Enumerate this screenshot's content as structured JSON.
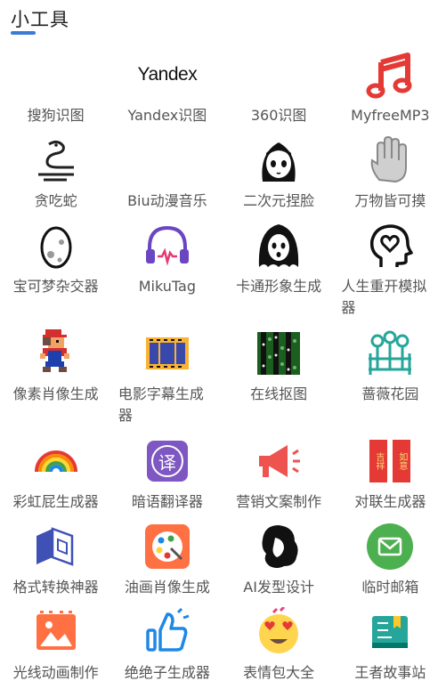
{
  "header": {
    "title": "小工具"
  },
  "tools": [
    {
      "label": "搜狗识图",
      "icon": "sogou-image-recognition-icon"
    },
    {
      "label": "Yandex识图",
      "icon": "yandex-logo-icon",
      "logo_text": "Yandex"
    },
    {
      "label": "360识图",
      "icon": "360-image-recognition-icon"
    },
    {
      "label": "MyfreeMP3",
      "icon": "music-note-icon"
    },
    {
      "label": "贪吃蛇",
      "icon": "snake-icon"
    },
    {
      "label": "Biu动漫音乐",
      "icon": "anime-music-icon"
    },
    {
      "label": "二次元捏脸",
      "icon": "anime-girl-face-icon"
    },
    {
      "label": "万物皆可摸",
      "icon": "hand-icon"
    },
    {
      "label": "宝可梦杂交器",
      "icon": "pokemon-egg-icon"
    },
    {
      "label": "MikuTag",
      "icon": "headphones-icon"
    },
    {
      "label": "卡通形象生成",
      "icon": "cartoon-ghost-icon"
    },
    {
      "label": "人生重开模拟器",
      "icon": "head-heart-icon"
    },
    {
      "label": "像素肖像生成",
      "icon": "pixel-mario-icon"
    },
    {
      "label": "电影字幕生成器",
      "icon": "film-strip-icon"
    },
    {
      "label": "在线抠图",
      "icon": "cutout-image-icon"
    },
    {
      "label": "蔷薇花园",
      "icon": "garden-fence-icon"
    },
    {
      "label": "彩虹屁生成器",
      "icon": "rainbow-icon"
    },
    {
      "label": "暗语翻译器",
      "icon": "translate-icon",
      "badge_text": "译"
    },
    {
      "label": "营销文案制作",
      "icon": "megaphone-icon"
    },
    {
      "label": "对联生成器",
      "icon": "couplet-icon",
      "couplet_left": "吉祥",
      "couplet_right": "如意"
    },
    {
      "label": "格式转换神器",
      "icon": "format-convert-icon"
    },
    {
      "label": "油画肖像生成",
      "icon": "palette-icon"
    },
    {
      "label": "AI发型设计",
      "icon": "hairstyle-icon"
    },
    {
      "label": "临时邮箱",
      "icon": "mail-icon"
    },
    {
      "label": "光线动画制作",
      "icon": "image-frame-icon"
    },
    {
      "label": "绝绝子生成器",
      "icon": "thumbs-up-icon"
    },
    {
      "label": "表情包大全",
      "icon": "heart-eyes-emoji-icon"
    },
    {
      "label": "王者故事站",
      "icon": "story-book-icon"
    }
  ],
  "colors": {
    "accent": "#3a7bd5",
    "label": "#555555"
  }
}
